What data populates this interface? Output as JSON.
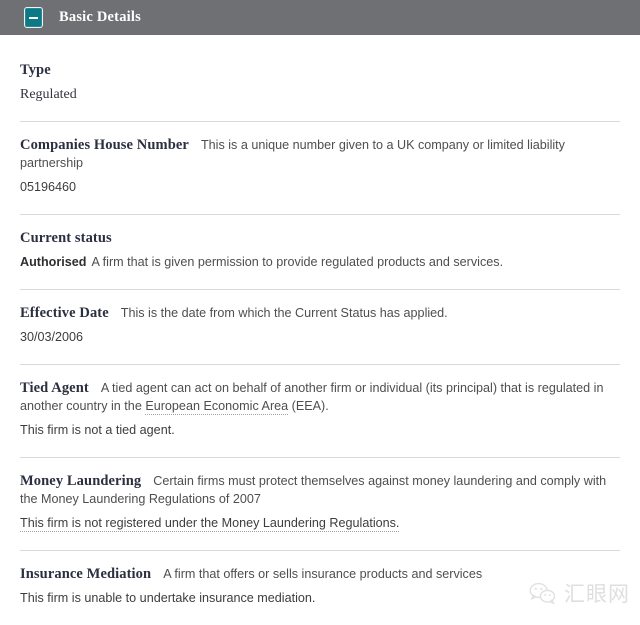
{
  "panel": {
    "title": "Basic Details",
    "collapse_icon": "minus-icon",
    "header_bg": "#6e7073",
    "toggle_color": "#0c7a86"
  },
  "sections": [
    {
      "id": "type",
      "label": "Type",
      "description": "",
      "value": "Regulated"
    },
    {
      "id": "companies-house-number",
      "label": "Companies House Number",
      "description": "This is a unique number given to a UK company or limited liability partnership",
      "value": "05196460"
    },
    {
      "id": "current-status",
      "label": "Current status",
      "description": "",
      "value_strong": "Authorised",
      "value_note": "A firm that is given permission to provide regulated products and services."
    },
    {
      "id": "effective-date",
      "label": "Effective Date",
      "description": "This is the date from which the Current Status has applied.",
      "value": "30/03/2006"
    },
    {
      "id": "tied-agent",
      "label": "Tied Agent",
      "description_part1": "A tied agent can act on behalf of another firm or individual (its principal) that is regulated in another country in the ",
      "description_term": "European Economic Area",
      "description_part2": " (EEA).",
      "value": "This firm is not a tied agent."
    },
    {
      "id": "money-laundering",
      "label": "Money Laundering",
      "description": "Certain firms must protect themselves against money laundering and comply with the Money Laundering Regulations of 2007",
      "value": "This firm is not registered under the Money Laundering Regulations."
    },
    {
      "id": "insurance-mediation",
      "label": "Insurance Mediation",
      "description": "A firm that offers or sells insurance products and services",
      "value": "This firm is unable to undertake insurance mediation."
    }
  ],
  "watermark": {
    "icon": "wechat-icon",
    "text": "汇眼网",
    "color": "#dcdcdc"
  }
}
